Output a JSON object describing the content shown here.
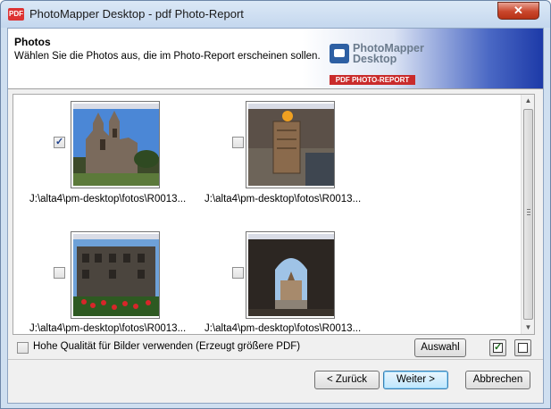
{
  "window": {
    "title": "PhotoMapper Desktop - pdf Photo-Report",
    "icon_label": "PDF",
    "close_symbol": "✕"
  },
  "header": {
    "title": "Photos",
    "description": "Wählen Sie die Photos aus, die im Photo-Report erscheinen sollen.",
    "logo_line1": "PhotoMapper",
    "logo_line2": "Desktop",
    "logo_banner": "PDF PHOTO-REPORT"
  },
  "photos": [
    {
      "path": "J:\\alta4\\pm-desktop\\fotos\\R0013...",
      "checked": true,
      "subject": "church-photo"
    },
    {
      "path": "J:\\alta4\\pm-desktop\\fotos\\R0013...",
      "checked": false,
      "subject": "memorial-stone-photo"
    },
    {
      "path": "J:\\alta4\\pm-desktop\\fotos\\R0013...",
      "checked": false,
      "subject": "roman-gate-photo"
    },
    {
      "path": "J:\\alta4\\pm-desktop\\fotos\\R0013...",
      "checked": false,
      "subject": "archway-photo"
    }
  ],
  "options": {
    "quality_label": "Hohe Qualität für Bilder verwenden (Erzeugt größere PDF)",
    "quality_checked": false
  },
  "toolbar": {
    "selection_label": "Auswahl"
  },
  "footer": {
    "back_label": "< Zurück",
    "next_label": "Weiter >",
    "cancel_label": "Abbrechen"
  }
}
